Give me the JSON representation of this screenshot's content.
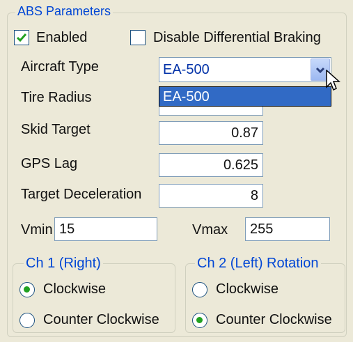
{
  "abs_group": {
    "title": "ABS Parameters",
    "enabled_label": "Enabled",
    "enabled_checked": true,
    "disable_diff_label": "Disable Differential Braking",
    "disable_diff_checked": false
  },
  "fields": {
    "aircraft_type_label": "Aircraft Type",
    "aircraft_type_value": "EA-500",
    "aircraft_type_options": [
      "EA-500"
    ],
    "tire_radius_label": "Tire Radius",
    "tire_radius_value": "",
    "skid_target_label": "Skid Target",
    "skid_target_value": "0.87",
    "gps_lag_label": "GPS Lag",
    "gps_lag_value": "0.625",
    "target_decel_label": "Target Deceleration",
    "target_decel_value": "8",
    "vmin_label": "Vmin",
    "vmin_value": "15",
    "vmax_label": "Vmax",
    "vmax_value": "255"
  },
  "ch1": {
    "title": "Ch 1 (Right)",
    "clockwise_label": "Clockwise",
    "counter_label": "Counter Clockwise",
    "selected": "clockwise"
  },
  "ch2": {
    "title": "Ch 2 (Left) Rotation",
    "clockwise_label": "Clockwise",
    "counter_label": "Counter Clockwise",
    "selected": "counter"
  },
  "icons": [
    "checkmark-icon",
    "chevron-down-icon",
    "mouse-pointer-icon"
  ],
  "colors": {
    "accent": "#0046d5",
    "selection": "#316ac5",
    "radio_dot": "#21a121"
  }
}
